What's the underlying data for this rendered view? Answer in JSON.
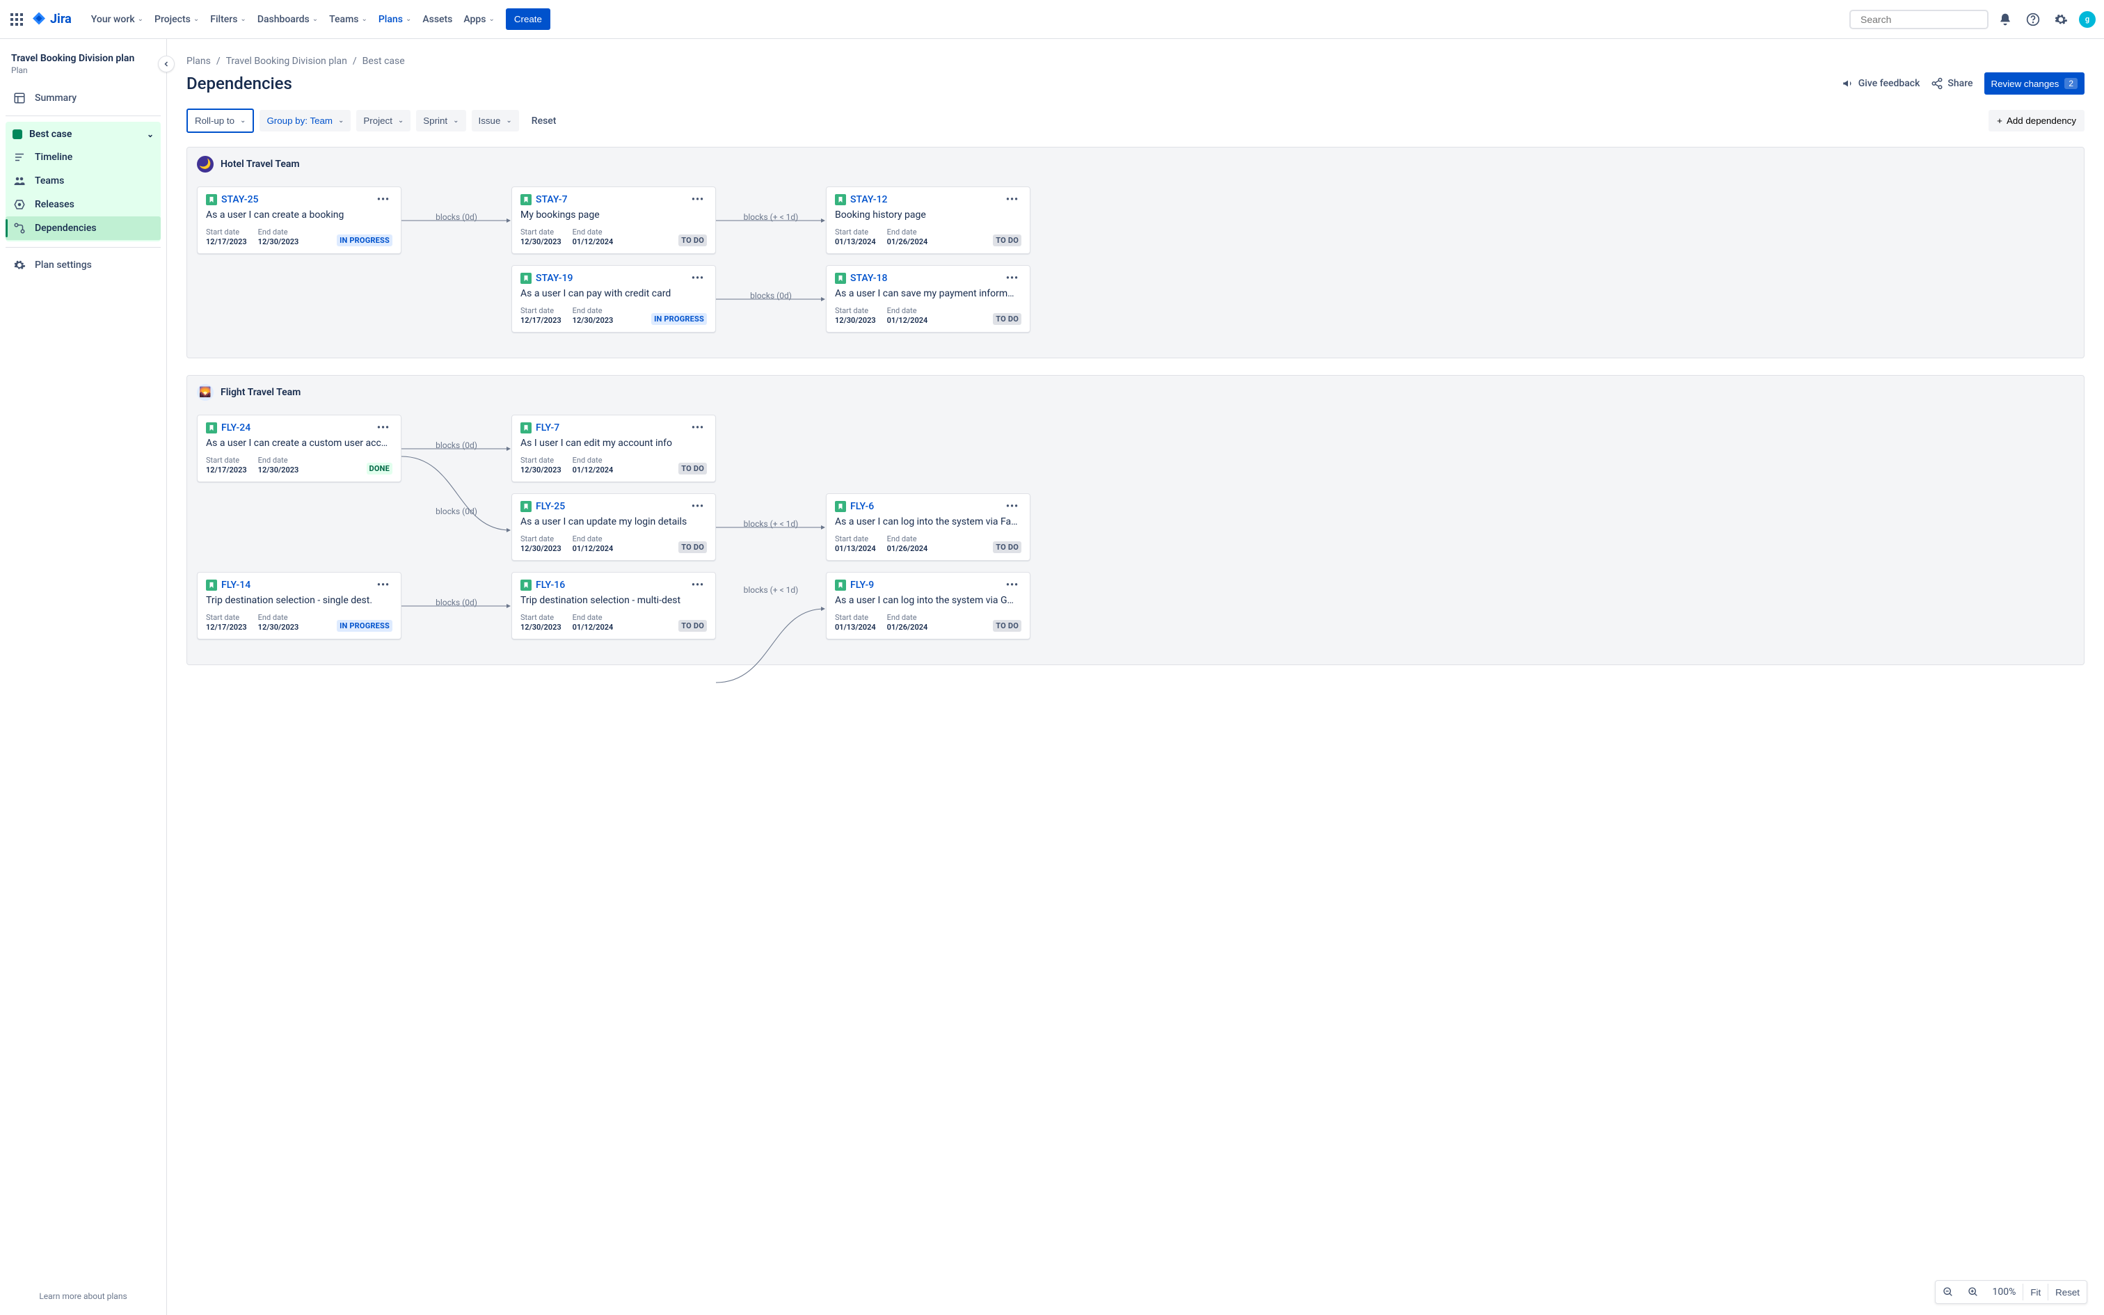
{
  "topnav": {
    "product": "Jira",
    "items": [
      "Your work",
      "Projects",
      "Filters",
      "Dashboards",
      "Teams",
      "Plans",
      "Assets",
      "Apps"
    ],
    "active_index": 5,
    "create": "Create",
    "search_placeholder": "Search"
  },
  "sidebar": {
    "plan_title": "Travel Booking Division plan",
    "plan_sub": "Plan",
    "summary": "Summary",
    "scenario": "Best case",
    "children": [
      "Timeline",
      "Teams",
      "Releases",
      "Dependencies"
    ],
    "selected_child_index": 3,
    "settings": "Plan settings",
    "footer": "Learn more about plans"
  },
  "breadcrumbs": [
    "Plans",
    "Travel Booking Division plan",
    "Best case"
  ],
  "page": {
    "title": "Dependencies",
    "give_feedback": "Give feedback",
    "share": "Share",
    "review": "Review changes",
    "review_count": "2"
  },
  "filters": {
    "rollup": "Roll-up to",
    "groupby_label": "Group by:",
    "groupby_value": "Team",
    "project": "Project",
    "sprint": "Sprint",
    "issue": "Issue",
    "reset": "Reset",
    "add_dep": "Add dependency"
  },
  "labels": {
    "start_date": "Start date",
    "end_date": "End date"
  },
  "status": {
    "todo": "TO DO",
    "in_progress": "IN PROGRESS",
    "done": "DONE"
  },
  "zoom": {
    "value": "100%",
    "fit": "Fit",
    "reset": "Reset"
  },
  "teams": [
    {
      "name": "Hotel Travel Team",
      "icon_color": "purple",
      "icon_glyph": "🌙",
      "rows": [
        {
          "cells": [
            {
              "key": "STAY-25",
              "summary": "As a user I can create a booking",
              "start": "12/17/2023",
              "end": "12/30/2023",
              "status": "in_progress"
            },
            {
              "key": "STAY-7",
              "summary": "My bookings page",
              "start": "12/30/2023",
              "end": "01/12/2024",
              "status": "todo"
            },
            {
              "key": "STAY-12",
              "summary": "Booking history page",
              "start": "01/13/2024",
              "end": "01/26/2024",
              "status": "todo"
            }
          ],
          "conns": [
            {
              "label": "blocks (0d)"
            },
            {
              "label": "blocks (+ < 1d)"
            }
          ]
        },
        {
          "cells": [
            null,
            {
              "key": "STAY-19",
              "summary": "As a user I can pay with credit card",
              "start": "12/17/2023",
              "end": "12/30/2023",
              "status": "in_progress"
            },
            {
              "key": "STAY-18",
              "summary": "As a user I can save my payment inform…",
              "start": "12/30/2023",
              "end": "01/12/2024",
              "status": "todo"
            }
          ],
          "conns": [
            null,
            {
              "label": "blocks (0d)"
            }
          ]
        }
      ]
    },
    {
      "name": "Flight Travel Team",
      "icon_color": "blue",
      "icon_glyph": "🌄",
      "rows": [
        {
          "cells": [
            {
              "key": "FLY-24",
              "summary": "As a user I can create a custom user acc…",
              "start": "12/17/2023",
              "end": "12/30/2023",
              "status": "done"
            },
            {
              "key": "FLY-7",
              "summary": "As I user I can edit my account info",
              "start": "12/30/2023",
              "end": "01/12/2024",
              "status": "todo"
            },
            null
          ],
          "conns": [
            {
              "label": "blocks (0d)"
            },
            null
          ]
        },
        {
          "cells": [
            null,
            {
              "key": "FLY-25",
              "summary": "As a user I can update my login details",
              "start": "12/30/2023",
              "end": "01/12/2024",
              "status": "todo"
            },
            {
              "key": "FLY-6",
              "summary": "As a user I can log into the system via Fa…",
              "start": "01/13/2024",
              "end": "01/26/2024",
              "status": "todo"
            }
          ],
          "conns": [
            {
              "label": "blocks (0d)",
              "curve": true
            },
            {
              "label": "blocks (+ < 1d)"
            }
          ]
        },
        {
          "cells": [
            {
              "key": "FLY-14",
              "summary": "Trip destination selection - single dest.",
              "start": "12/17/2023",
              "end": "12/30/2023",
              "status": "in_progress"
            },
            {
              "key": "FLY-16",
              "summary": "Trip destination selection - multi-dest",
              "start": "12/30/2023",
              "end": "01/12/2024",
              "status": "todo"
            },
            {
              "key": "FLY-9",
              "summary": "As a user I can log into the system via G…",
              "start": "01/13/2024",
              "end": "01/26/2024",
              "status": "todo"
            }
          ],
          "conns": [
            {
              "label": "blocks (0d)"
            },
            {
              "label": "blocks (+ < 1d)",
              "curve_up": true
            }
          ]
        }
      ]
    }
  ]
}
